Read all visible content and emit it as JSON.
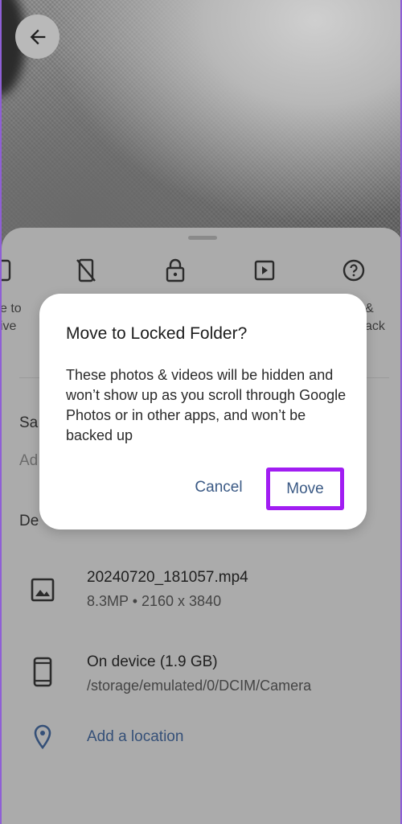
{
  "header": {
    "back_icon": "arrow-left-icon"
  },
  "actions": [
    {
      "icon": "drive-icon",
      "label_partial_line1": "e to",
      "label_partial_line2": "ive"
    },
    {
      "icon": "phone-off-icon"
    },
    {
      "icon": "lock-icon"
    },
    {
      "icon": "slideshow-icon"
    },
    {
      "icon": "help-circle-icon",
      "label_partial_line1": "&",
      "label_partial_line2": "ack"
    }
  ],
  "background_rows": {
    "section1_title_partial": "Sa",
    "section1_sub_partial": "Ad",
    "section2_title_partial": "De"
  },
  "details": {
    "file_name": "20240720_181057.mp4",
    "file_meta": "8.3MP  •  2160 x 3840",
    "storage_title": "On device (1.9 GB)",
    "storage_path": "/storage/emulated/0/DCIM/Camera",
    "location_link": "Add a location"
  },
  "dialog": {
    "title": "Move to Locked Folder?",
    "body": "These photos & videos will be hidden and won’t show up as you scroll through Google Photos or in other apps, and won’t be backed up",
    "cancel_label": "Cancel",
    "move_label": "Move",
    "highlight_color": "#a11df2"
  }
}
